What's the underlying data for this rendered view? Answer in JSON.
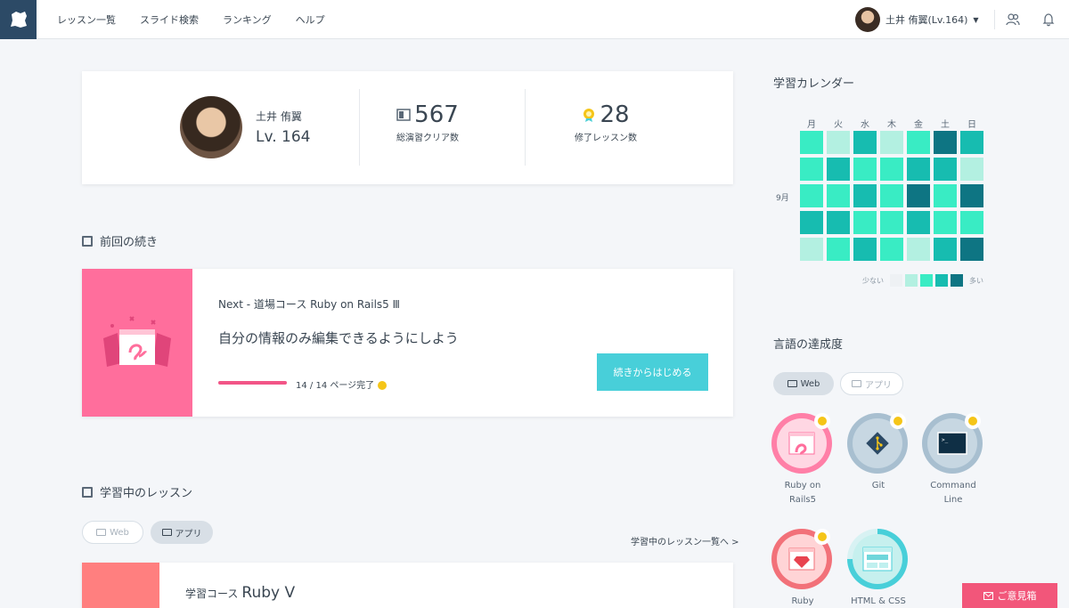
{
  "header": {
    "nav": [
      "レッスン一覧",
      "スライド検索",
      "ランキング",
      "ヘルプ"
    ],
    "user_label": "土井 侑翼(Lv.164)"
  },
  "profile": {
    "name": "土井 侑翼",
    "level": "Lv. 164",
    "exercises_value": "567",
    "exercises_label": "総演習クリア数",
    "lessons_value": "28",
    "lessons_label": "修了レッスン数"
  },
  "continue": {
    "heading": "前回の続き",
    "next": "Next - 道場コース Ruby on Rails5 Ⅲ",
    "title": "自分の情報のみ編集できるようにしよう",
    "progress_text": "14 / 14 ページ完了",
    "progress": 1.0,
    "button": "続きからはじめる"
  },
  "learning": {
    "heading": "学習中のレッスン",
    "tab_web": "Web",
    "tab_app": "アプリ",
    "more": "学習中のレッスン一覧へ >",
    "lesson_prefix": "学習コース",
    "lesson_name": "Ruby Ⅴ"
  },
  "calendar": {
    "heading": "学習カレンダー",
    "days": [
      "月",
      "火",
      "水",
      "木",
      "金",
      "土",
      "日"
    ],
    "month": "9月",
    "less": "少ない",
    "more": "多い",
    "levels": [
      [
        2,
        1,
        3,
        1,
        2,
        4,
        3
      ],
      [
        2,
        3,
        2,
        2,
        3,
        3,
        1
      ],
      [
        2,
        2,
        3,
        2,
        4,
        2,
        4
      ],
      [
        3,
        3,
        2,
        2,
        3,
        2,
        2
      ],
      [
        1,
        2,
        3,
        2,
        1,
        3,
        4
      ]
    ],
    "colors": [
      "#eef1f4",
      "#b3f0e1",
      "#39ecc4",
      "#17bcb0",
      "#0e7583"
    ]
  },
  "languages": {
    "heading": "言語の達成度",
    "tab_web": "Web",
    "tab_app": "アプリ",
    "items": [
      {
        "name": "Ruby on Rails5",
        "icon": "rails-icon",
        "ring": "#ff7fa7",
        "fill": "#ffd7e3",
        "medal": true
      },
      {
        "name": "Git",
        "icon": "git-icon",
        "ring": "#a8bfd0",
        "fill": "#c7d7e2",
        "medal": true
      },
      {
        "name": "Command Line",
        "icon": "terminal-icon",
        "ring": "#a8bfd0",
        "fill": "#c7d7e2",
        "medal": true
      },
      {
        "name": "Ruby",
        "icon": "ruby-icon",
        "ring": "#f27179",
        "fill": "#ffd4d6",
        "medal": true
      },
      {
        "name": "HTML & CSS",
        "icon": "html-icon",
        "ring": "#48cfd9",
        "fill": "#c6f0ee",
        "medal": false
      }
    ]
  },
  "feedback": "ご意見箱",
  "colors": {
    "accent": "#48cfd9",
    "pink": "#f25587",
    "navy": "#2c4a66"
  }
}
